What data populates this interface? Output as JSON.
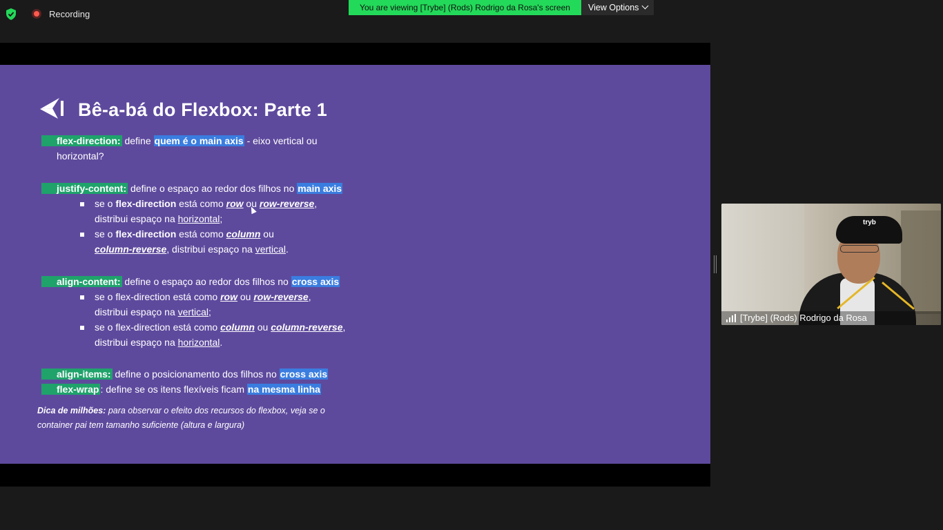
{
  "topbar": {
    "recording_label": "Recording",
    "viewing_banner": "You are viewing [Trybe]  (Rods) Rodrigo da Rosa's screen",
    "view_options_label": "View Options"
  },
  "slide": {
    "title": "Bê-a-bá do Flexbox: Parte 1",
    "flex_direction": {
      "label": "flex-direction:",
      "text1": " define ",
      "highlight": "quem é o main axis",
      "text2": " - eixo vertical ou",
      "text3": "horizontal?"
    },
    "justify_content": {
      "label": "justify-content:",
      "text1": " define o espaço ao redor dos filhos no ",
      "highlight": "main axis",
      "sub1": {
        "a": "se o ",
        "b": "flex-direction",
        "c": " está como ",
        "d": "row",
        "e": " ou ",
        "f": "row-reverse",
        "g": ",",
        "h": "distribui espaço na ",
        "i": "horizontal",
        "j": ";"
      },
      "sub2": {
        "a": "se o ",
        "b": "flex-direction",
        "c": " está como ",
        "d": "column",
        "e": " ou",
        "f": "column-reverse",
        "g": ", distribui espaço na ",
        "h": "vertical",
        "i": "."
      }
    },
    "align_content": {
      "label": "align-content:",
      "text1": " define o espaço ao redor dos filhos no ",
      "highlight": "cross axis",
      "sub1": {
        "a": "se o flex-direction  está como ",
        "b": "row",
        "c": " ou ",
        "d": "row-reverse",
        "e": ",",
        "f": "distribui espaço na ",
        "g": "vertical",
        "h": ";"
      },
      "sub2": {
        "a": "se o flex-direction está como ",
        "b": "column",
        "c": " ou ",
        "d": "column-reverse",
        "e": ",",
        "f": "distribui espaço na ",
        "g": "horizontal",
        "h": "."
      }
    },
    "align_items": {
      "label": "align-items:",
      "text1": " define o posicionamento dos filhos no ",
      "highlight": "cross axis"
    },
    "flex_wrap": {
      "label": "flex-wrap",
      "text1": ": define se os itens flexíveis ficam ",
      "highlight": "na mesma linha"
    },
    "tip": {
      "bold": "Dica de milhões:",
      "text1": " para observar o efeito dos recursos do flexbox, veja se o",
      "text2": "container pai tem tamanho suficiente (altura e largura)"
    }
  },
  "video": {
    "participant_name": "[Trybe]  (Rods) Rodrigo da Rosa",
    "cap_logo": "tryb"
  },
  "colors": {
    "slide_bg": "#5e4a9d",
    "green_highlight": "#1fa36b",
    "blue_highlight": "#3a7de0",
    "banner_green": "#23d959"
  }
}
